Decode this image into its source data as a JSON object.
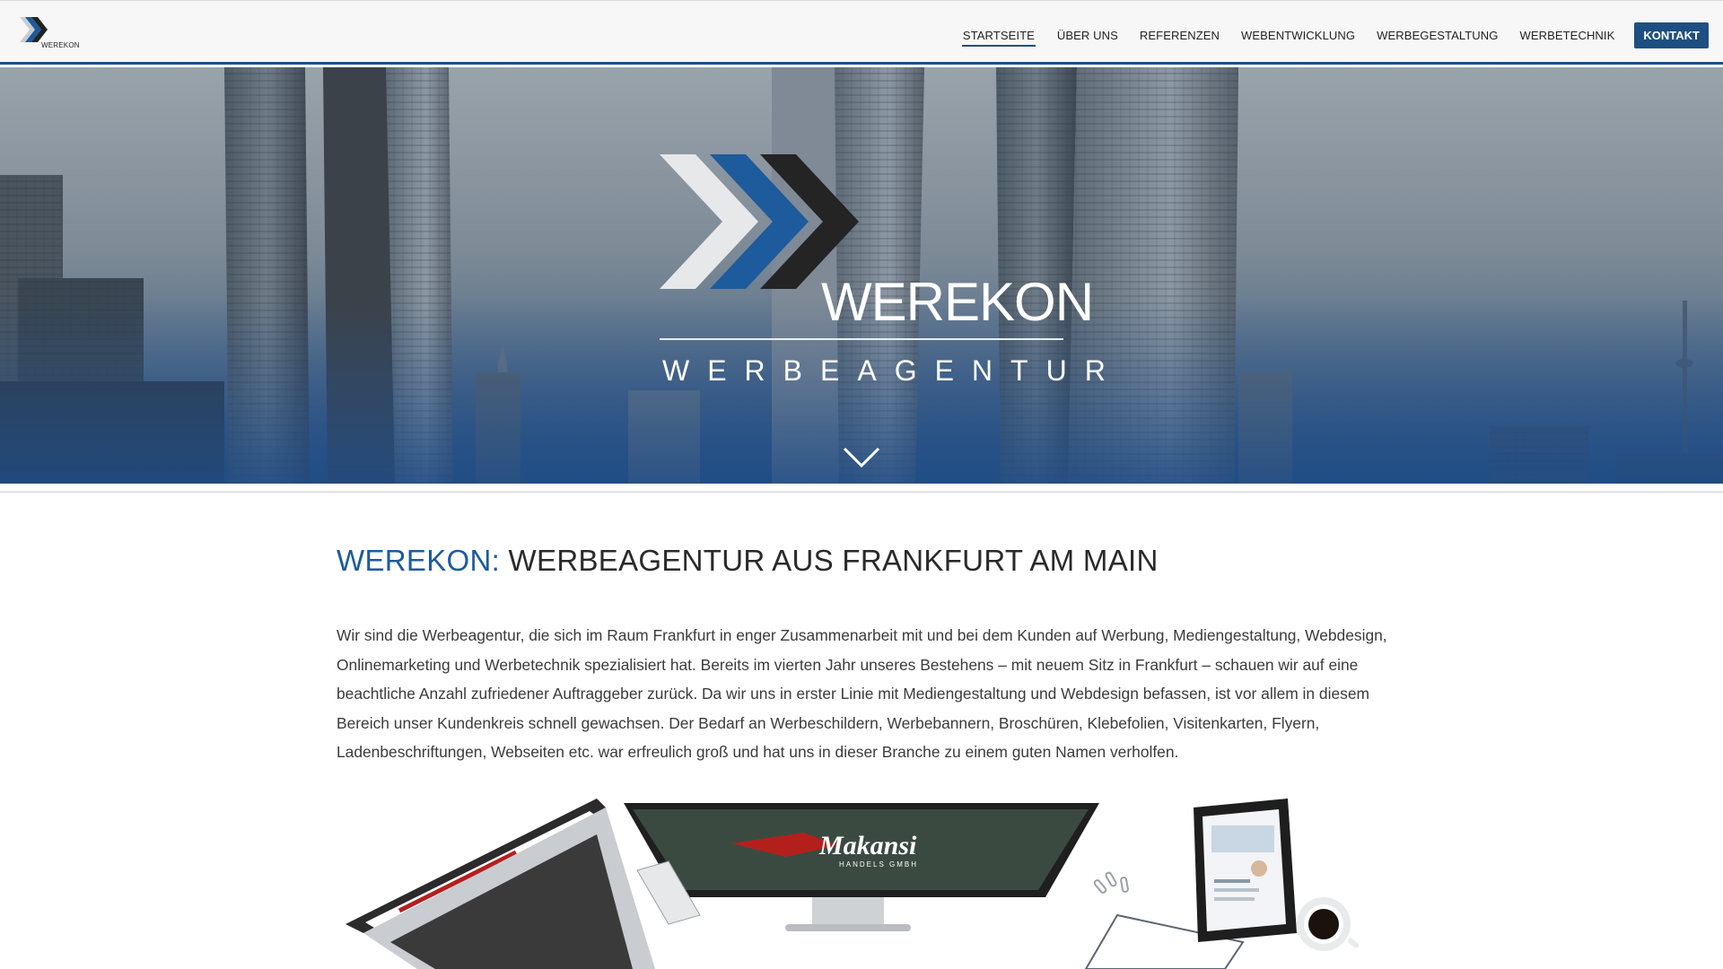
{
  "header": {
    "logo_text": "WEREKON",
    "nav": [
      {
        "label": "STARTSEITE",
        "active": true
      },
      {
        "label": "ÜBER UNS",
        "active": false
      },
      {
        "label": "REFERENZEN",
        "active": false
      },
      {
        "label": "WEBENTWICKLUNG",
        "active": false
      },
      {
        "label": "WERBEGESTALTUNG",
        "active": false
      },
      {
        "label": "WERBETECHNIK",
        "active": false
      }
    ],
    "cta_label": "KONTAKT"
  },
  "hero": {
    "brand": "WEREKON",
    "subtitle": "WERBEAGENTUR"
  },
  "main": {
    "title_accent": "WEREKON:",
    "title_rest": " WERBEAGENTUR AUS FRANKFURT AM MAIN",
    "intro": "Wir sind die Werbeagentur, die sich im Raum Frankfurt in enger Zusammenarbeit mit und bei dem Kunden auf Werbung, Mediengestaltung, Webdesign, Onlinemarketing und Werbetechnik spezialisiert hat. Bereits im vierten Jahr unseres Bestehens – mit neuem Sitz in Frankfurt – schauen wir auf eine beachtliche Anzahl zufriedener Auftraggeber zurück. Da wir uns in erster Linie mit Mediengestaltung und Webdesign befassen, ist vor allem in diesem Bereich unser Kundenkreis schnell gewachsen. Der Bedarf an Werbeschildern, Werbebannern, Broschüren, Klebefolien, Visitenkarten, Flyern, Ladenbeschriftungen, Webseiten etc. war erfreulich groß und hat uns in dieser Branche zu einem guten Namen verholfen."
  },
  "devices": {
    "screen_brand": "Makansi",
    "screen_sub": "HANDELS GMBH"
  },
  "colors": {
    "accent": "#1d4f82",
    "title_accent": "#1d5b9c"
  }
}
